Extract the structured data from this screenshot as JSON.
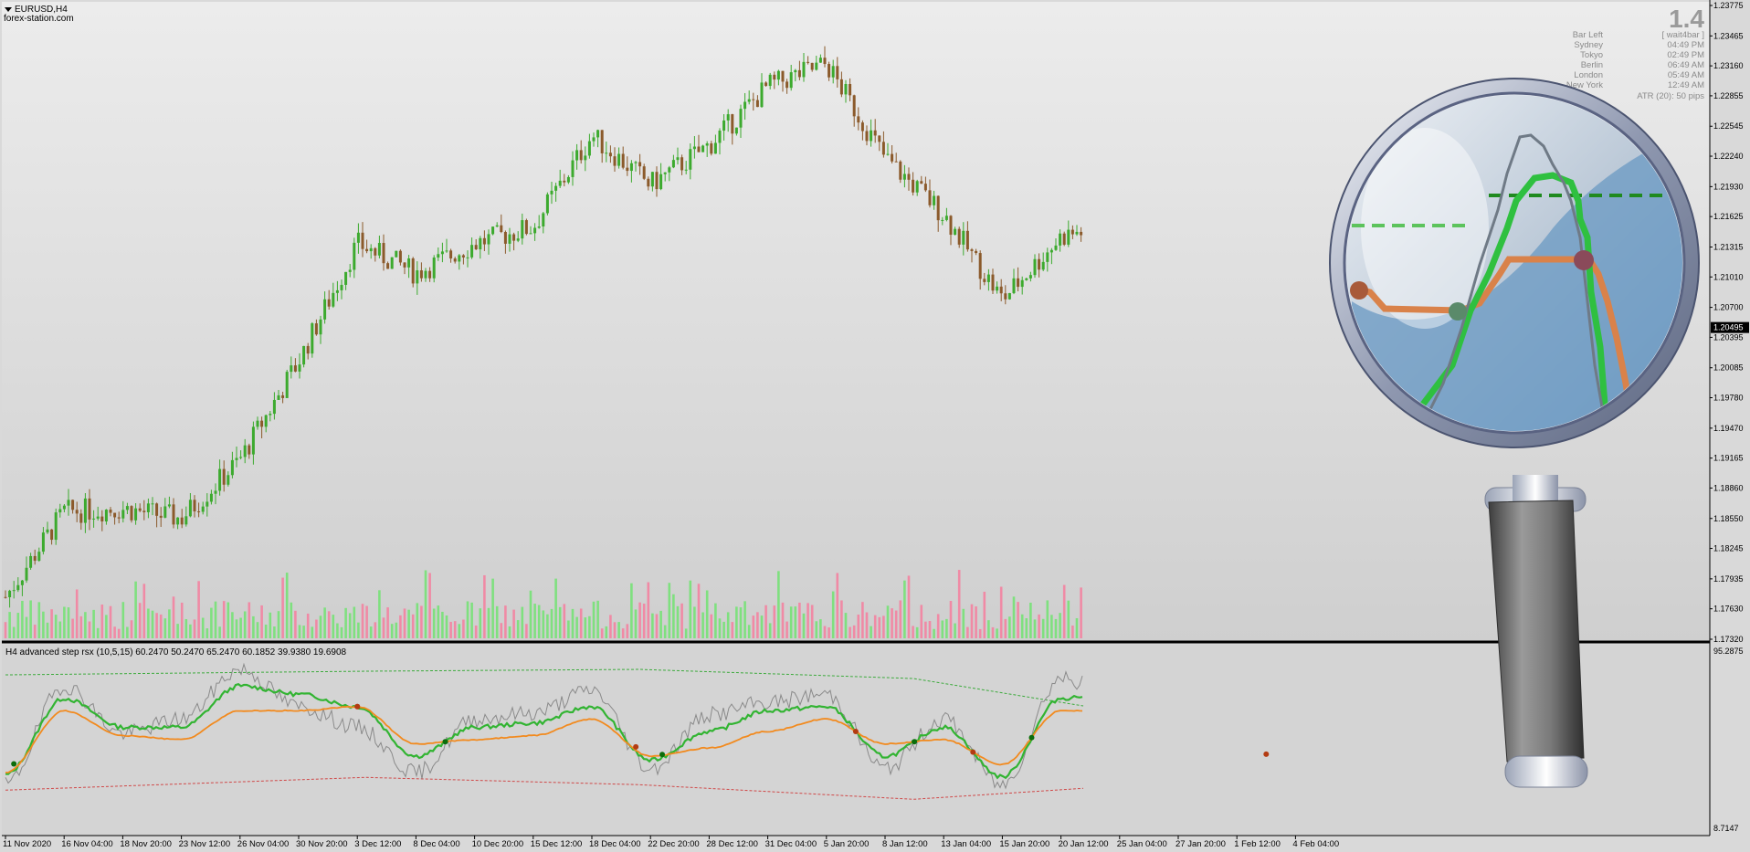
{
  "window": {
    "symbol_title": "EURUSD,H4",
    "watermark": "forex-station.com"
  },
  "info_panel": {
    "version": "1.4",
    "rows": [
      {
        "label": "Bar Left",
        "value": "[ wait4bar ]"
      },
      {
        "label": "Sydney",
        "value": "04:49 PM"
      },
      {
        "label": "Tokyo",
        "value": "02:49 PM"
      },
      {
        "label": "Berlin",
        "value": "06:49 AM"
      },
      {
        "label": "London",
        "value": "05:49 AM"
      },
      {
        "label": "New York",
        "value": "12:49 AM"
      }
    ],
    "atr_line": "ATR (20): 50 pips"
  },
  "price_axis": {
    "labels": [
      "1.23775",
      "1.23465",
      "1.23160",
      "1.22855",
      "1.22545",
      "1.22240",
      "1.21930",
      "1.21625",
      "1.21315",
      "1.21010",
      "1.20700",
      "1.20395",
      "1.20085",
      "1.19780",
      "1.19470",
      "1.19165",
      "1.18860",
      "1.18550",
      "1.18245",
      "1.17935",
      "1.17630",
      "1.17320"
    ],
    "current_price": "1.20495"
  },
  "indicator": {
    "title": "H4 advanced step rsx (10,5,15) 60.2470 50.2470 65.2470 60.1852 39.9380 19.6908",
    "scale_max": "95.2875",
    "scale_min": "8.7147"
  },
  "time_axis": {
    "labels": [
      "11 Nov 2020",
      "16 Nov 04:00",
      "18 Nov 20:00",
      "23 Nov 12:00",
      "26 Nov 04:00",
      "30 Nov 20:00",
      "3 Dec 12:00",
      "8 Dec 04:00",
      "10 Dec 20:00",
      "15 Dec 12:00",
      "18 Dec 04:00",
      "22 Dec 20:00",
      "28 Dec 12:00",
      "31 Dec 04:00",
      "5 Jan 20:00",
      "8 Jan 12:00",
      "13 Jan 04:00",
      "15 Jan 20:00",
      "20 Jan 12:00",
      "25 Jan 04:00",
      "27 Jan 20:00",
      "1 Feb 12:00",
      "4 Feb 04:00"
    ]
  },
  "colors": {
    "bull": "#3caa2e",
    "bear": "#8b5a2b",
    "volume_up": "#7fe07f",
    "volume_down": "#f08aa5",
    "rsx_line": "#32b432",
    "step_line": "#f28a1e",
    "raw_line": "#8a8a8a",
    "upper_band": "#3caa3c",
    "lower_band": "#d04848",
    "dot_green": "#0b6d0b",
    "dot_red": "#b33b12"
  },
  "chart_data": [
    {
      "type": "candlestick",
      "title": "EURUSD,H4",
      "ylim": [
        1.1732,
        1.23775
      ],
      "anchors": [
        {
          "x": "11 Nov 2020",
          "close": 1.1775
        },
        {
          "x": "16 Nov 04:00",
          "close": 1.1862
        },
        {
          "x": "18 Nov 20:00",
          "close": 1.1865
        },
        {
          "x": "23 Nov 12:00",
          "close": 1.1855
        },
        {
          "x": "26 Nov 04:00",
          "close": 1.1915
        },
        {
          "x": "30 Nov 20:00",
          "close": 1.2015
        },
        {
          "x": "3 Dec 12:00",
          "close": 1.2135
        },
        {
          "x": "8 Dec 04:00",
          "close": 1.2105
        },
        {
          "x": "10 Dec 20:00",
          "close": 1.2135
        },
        {
          "x": "15 Dec 12:00",
          "close": 1.2152
        },
        {
          "x": "18 Dec 04:00",
          "close": 1.2245
        },
        {
          "x": "22 Dec 20:00",
          "close": 1.2195
        },
        {
          "x": "28 Dec 12:00",
          "close": 1.2235
        },
        {
          "x": "31 Dec 04:00",
          "close": 1.2295
        },
        {
          "x": "5 Jan 20:00",
          "close": 1.2318
        },
        {
          "x": "8 Jan 12:00",
          "close": 1.2222
        },
        {
          "x": "13 Jan 04:00",
          "close": 1.2165
        },
        {
          "x": "15 Jan 20:00",
          "close": 1.2078
        },
        {
          "x": "20 Jan 12:00",
          "close": 1.2142
        },
        {
          "x": "25 Jan 04:00",
          "close": 1.2158
        },
        {
          "x": "27 Jan 20:00",
          "close": 1.2115
        },
        {
          "x": "1 Feb 12:00",
          "close": 1.2052
        },
        {
          "x": "4 Feb 04:00",
          "close": 1.1975
        }
      ],
      "last_close": 1.20495,
      "volume_range": [
        0,
        100
      ]
    },
    {
      "type": "line",
      "title": "H4 advanced step rsx (10,5,15)",
      "ylim": [
        8.7147,
        95.2875
      ],
      "x": [
        "11 Nov 2020",
        "16 Nov 04:00",
        "18 Nov 20:00",
        "23 Nov 12:00",
        "26 Nov 04:00",
        "30 Nov 20:00",
        "3 Dec 12:00",
        "8 Dec 04:00",
        "10 Dec 20:00",
        "15 Dec 12:00",
        "18 Dec 04:00",
        "22 Dec 20:00",
        "28 Dec 12:00",
        "31 Dec 04:00",
        "5 Jan 20:00",
        "8 Jan 12:00",
        "13 Jan 04:00",
        "15 Jan 20:00",
        "20 Jan 12:00",
        "25 Jan 04:00",
        "27 Jan 20:00",
        "1 Feb 12:00",
        "4 Feb 04:00"
      ],
      "series": [
        {
          "values": [
            30,
            78,
            55,
            62,
            86,
            68,
            58,
            36,
            62,
            65,
            76,
            38,
            64,
            70,
            74,
            38,
            62,
            30,
            82,
            72,
            48,
            52,
            36
          ]
        },
        {
          "values": [
            35,
            72,
            58,
            58,
            78,
            74,
            68,
            44,
            58,
            60,
            68,
            42,
            56,
            66,
            68,
            44,
            58,
            34,
            72,
            76,
            52,
            50,
            40
          ]
        },
        {
          "values": [
            36,
            66,
            54,
            52,
            66,
            66,
            68,
            50,
            52,
            54,
            62,
            44,
            48,
            56,
            62,
            50,
            52,
            40,
            66,
            66,
            48,
            46,
            44
          ]
        }
      ],
      "bands": {
        "upper": 86,
        "lower": 32
      },
      "last_value": 60.1852
    }
  ]
}
